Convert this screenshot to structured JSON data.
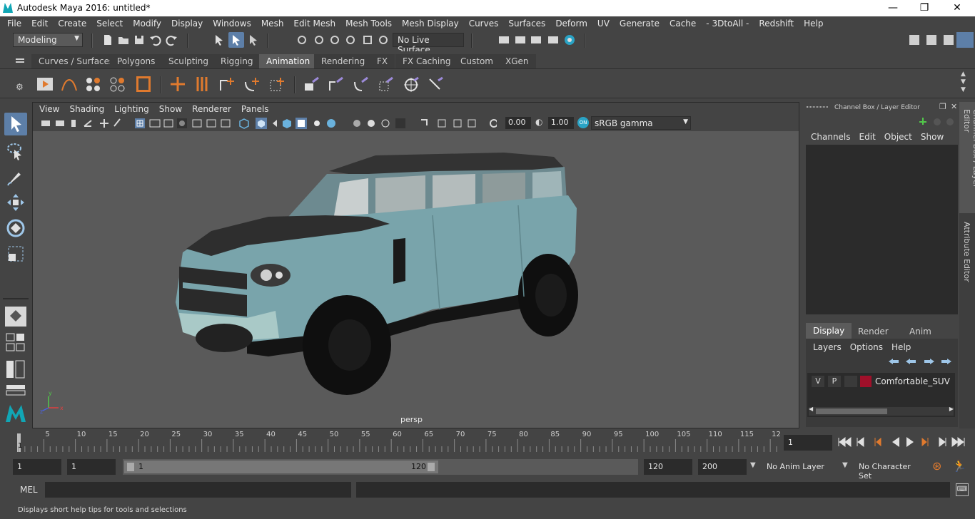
{
  "window": {
    "title": "Autodesk Maya 2016: untitled*",
    "minimize": "—",
    "maximize": "❐",
    "close": "✕"
  },
  "menubar": [
    "File",
    "Edit",
    "Create",
    "Select",
    "Modify",
    "Display",
    "Windows",
    "Mesh",
    "Edit Mesh",
    "Mesh Tools",
    "Mesh Display",
    "Curves",
    "Surfaces",
    "Deform",
    "UV",
    "Generate",
    "Cache",
    "- 3DtoAll -",
    "Redshift",
    "Help"
  ],
  "status": {
    "mode": "Modeling",
    "live_surface": "No Live Surface"
  },
  "shelf_tabs": [
    "Curves / Surfaces",
    "Polygons",
    "Sculpting",
    "Rigging",
    "Animation",
    "Rendering",
    "FX",
    "FX Caching",
    "Custom",
    "XGen"
  ],
  "active_shelf_tab": "Animation",
  "viewport": {
    "menu": [
      "View",
      "Shading",
      "Lighting",
      "Show",
      "Renderer",
      "Panels"
    ],
    "exposure": "0.00",
    "gamma": "1.00",
    "color_space": "sRGB gamma",
    "camera_label": "persp"
  },
  "channel_box": {
    "title": "Channel Box / Layer Editor",
    "menu": [
      "Channels",
      "Edit",
      "Object",
      "Show"
    ]
  },
  "layer_editor": {
    "tabs": [
      "Display",
      "Render",
      "Anim"
    ],
    "active_tab": "Display",
    "menu": [
      "Layers",
      "Options",
      "Help"
    ],
    "layer": {
      "v": "V",
      "p": "P",
      "name": "Comfortable_SUV",
      "color": "#a0102a"
    }
  },
  "side_tabs": [
    "Channel Box / Layer Editor",
    "Attribute Editor"
  ],
  "timeline": {
    "ticks": [
      "5",
      "10",
      "15",
      "20",
      "25",
      "30",
      "35",
      "40",
      "45",
      "50",
      "55",
      "60",
      "65",
      "70",
      "75",
      "80",
      "85",
      "90",
      "95",
      "100",
      "105",
      "110",
      "115",
      "12"
    ],
    "current_frame_marker": "1",
    "current_frame": "1"
  },
  "range": {
    "start": "1",
    "start2": "1",
    "slider_start": "1",
    "slider_end": "120",
    "end": "120",
    "end2": "200",
    "anim_layer": "No Anim Layer",
    "character_set": "No Character Set"
  },
  "command_line": {
    "label": "MEL"
  },
  "help_line": "Displays short help tips for tools and selections",
  "colors": {
    "accent": "#5d7fa8",
    "vehicle": "#79a4ab",
    "layer_swatch": "#a0102a"
  }
}
